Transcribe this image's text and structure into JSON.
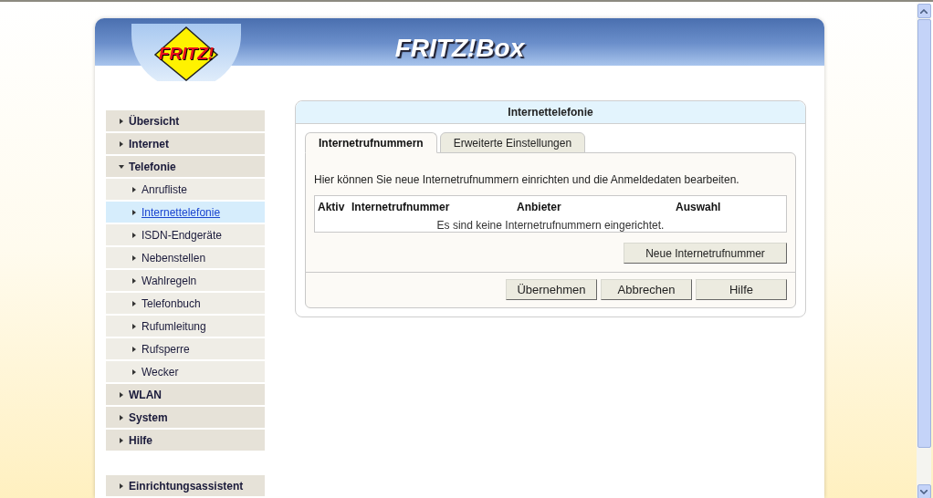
{
  "header": {
    "logo": "FRITZ!",
    "product": "FRITZ!Box"
  },
  "sidebar": {
    "items": [
      {
        "label": "Übersicht",
        "expanded": false
      },
      {
        "label": "Internet",
        "expanded": false
      },
      {
        "label": "Telefonie",
        "expanded": true,
        "children": [
          {
            "label": "Anrufliste",
            "selected": false
          },
          {
            "label": "Internettelefonie",
            "selected": true
          },
          {
            "label": "ISDN-Endgeräte",
            "selected": false
          },
          {
            "label": "Nebenstellen",
            "selected": false
          },
          {
            "label": "Wahlregeln",
            "selected": false
          },
          {
            "label": "Telefonbuch",
            "selected": false
          },
          {
            "label": "Rufumleitung",
            "selected": false
          },
          {
            "label": "Rufsperre",
            "selected": false
          },
          {
            "label": "Wecker",
            "selected": false
          }
        ]
      },
      {
        "label": "WLAN",
        "expanded": false
      },
      {
        "label": "System",
        "expanded": false
      },
      {
        "label": "Hilfe",
        "expanded": false
      }
    ],
    "assistant": {
      "label": "Einrichtungsassistent",
      "expanded": false
    }
  },
  "panel": {
    "title": "Internettelefonie",
    "tabs": [
      {
        "label": "Internetrufnummern",
        "selected": true
      },
      {
        "label": "Erweiterte Einstellungen",
        "selected": false
      }
    ],
    "intro": "Hier können Sie neue Internetrufnummern einrichten und die Anmeldedaten bearbeiten.",
    "table": {
      "columns": [
        "Aktiv",
        "Internetrufnummer",
        "Anbieter",
        "Auswahl"
      ],
      "empty_message": "Es sind keine Internetrufnummern eingerichtet."
    },
    "add_button": "Neue Internetrufnummer",
    "buttons": [
      "Übernehmen",
      "Abbrechen",
      "Hilfe"
    ]
  }
}
